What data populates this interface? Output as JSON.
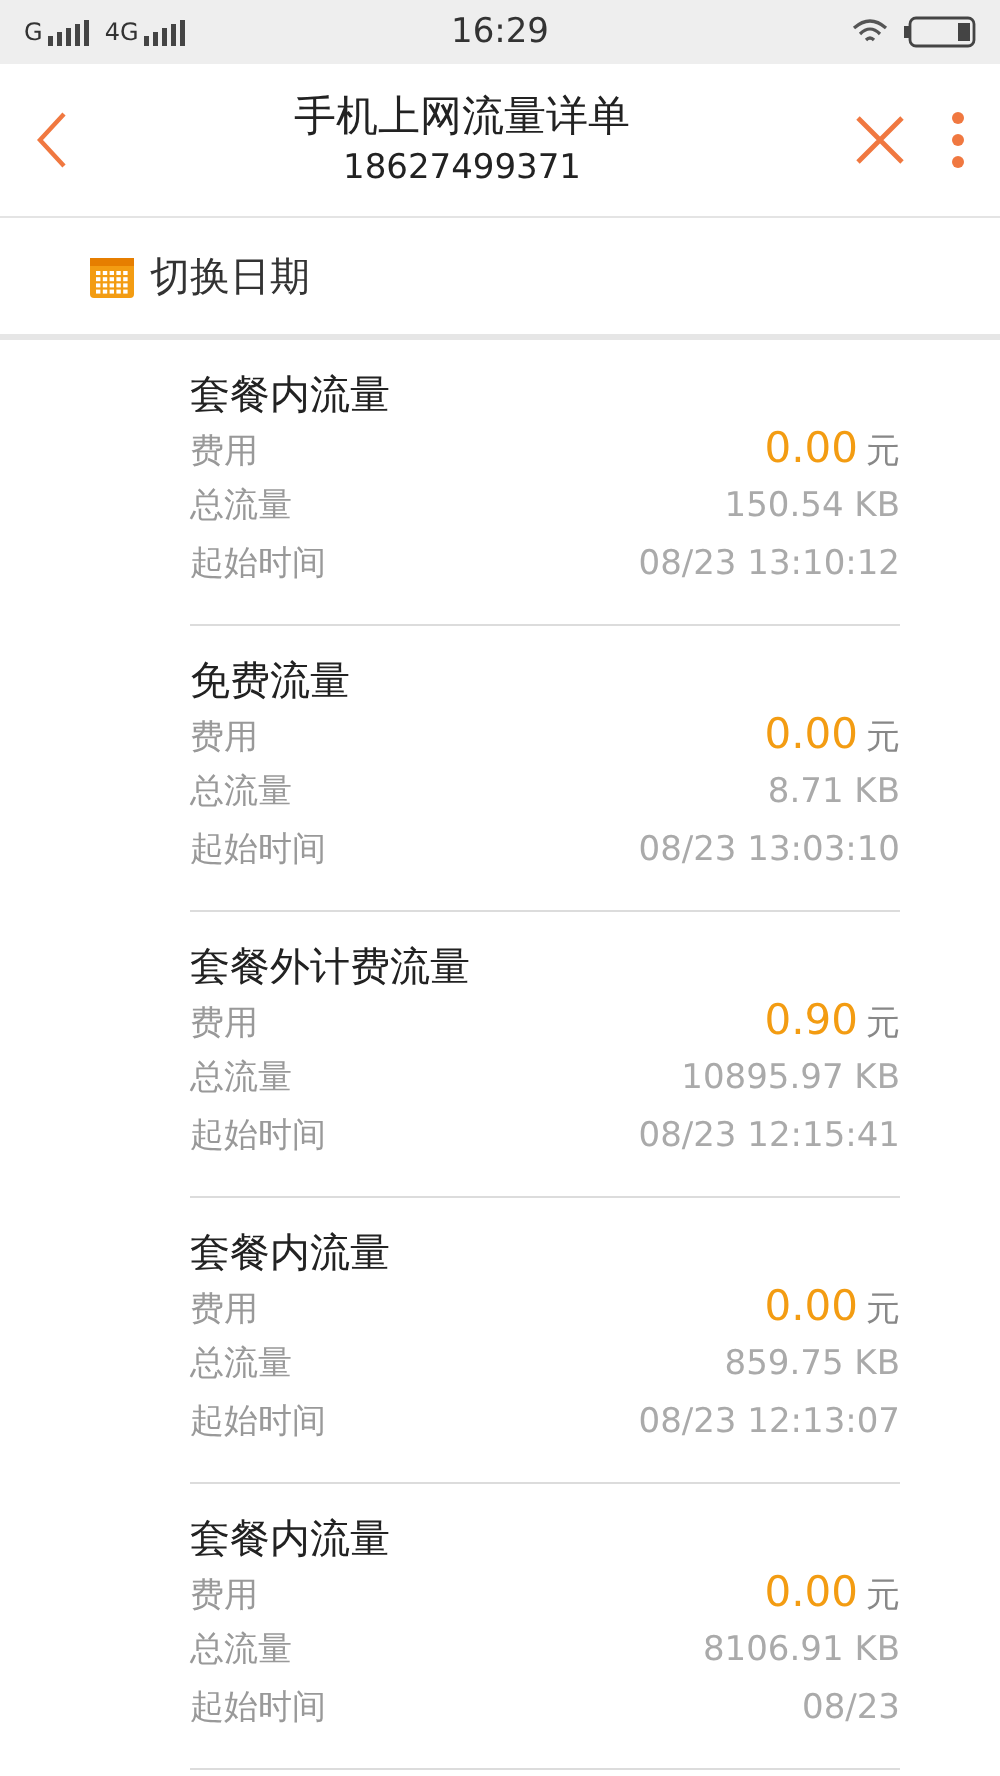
{
  "status_bar": {
    "network_1": "G",
    "network_2": "4G",
    "time": "16:29"
  },
  "header": {
    "title": "手机上网流量详单",
    "subtitle": "18627499371"
  },
  "date_switch": {
    "label": "切换日期"
  },
  "records": [
    {
      "type": "套餐内流量",
      "fee_label": "费用",
      "fee": "0.00",
      "unit": "元",
      "volume_label": "总流量",
      "volume": "150.54 KB",
      "time_label": "起始时间",
      "time": "08/23 13:10:12"
    },
    {
      "type": "免费流量",
      "fee_label": "费用",
      "fee": "0.00",
      "unit": "元",
      "volume_label": "总流量",
      "volume": "8.71 KB",
      "time_label": "起始时间",
      "time": "08/23 13:03:10"
    },
    {
      "type": "套餐外计费流量",
      "fee_label": "费用",
      "fee": "0.90",
      "unit": "元",
      "volume_label": "总流量",
      "volume": "10895.97 KB",
      "time_label": "起始时间",
      "time": "08/23 12:15:41"
    },
    {
      "type": "套餐内流量",
      "fee_label": "费用",
      "fee": "0.00",
      "unit": "元",
      "volume_label": "总流量",
      "volume": "859.75 KB",
      "time_label": "起始时间",
      "time": "08/23 12:13:07"
    },
    {
      "type": "套餐内流量",
      "fee_label": "费用",
      "fee": "0.00",
      "unit": "元",
      "volume_label": "总流量",
      "volume": "8106.91 KB",
      "time_label": "起始时间",
      "time": "08/23"
    }
  ]
}
